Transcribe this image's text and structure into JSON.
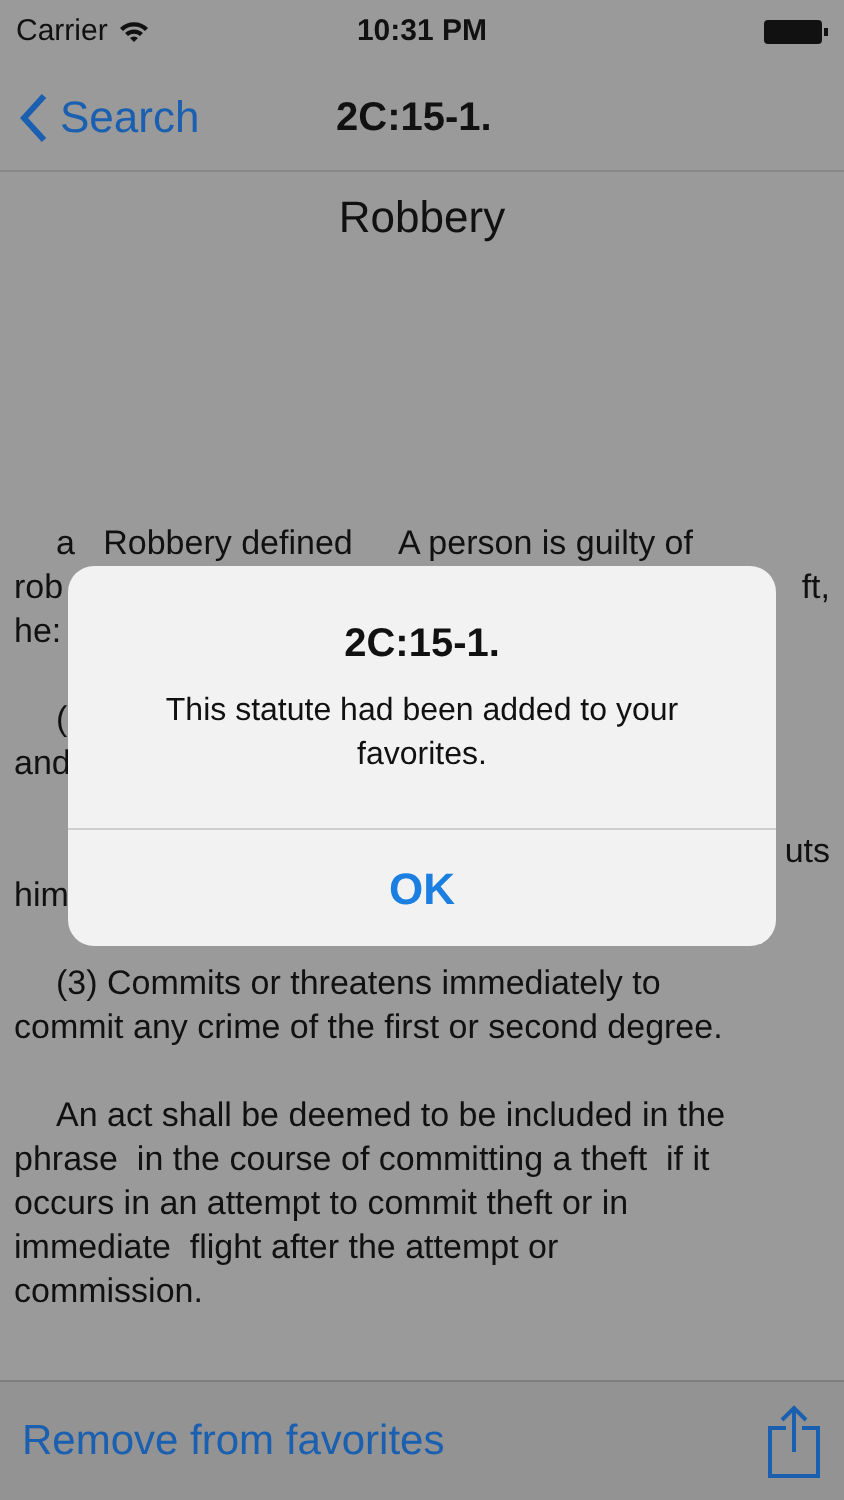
{
  "status_bar": {
    "carrier": "Carrier",
    "time": "10:31 PM"
  },
  "nav": {
    "back": "Search",
    "title": "2C:15-1."
  },
  "document": {
    "heading": "Robbery",
    "paragraphs": [
      {
        "lines": [
          {
            "left": "a   Robbery defined     A person is guilty of",
            "indent": true
          },
          {
            "left": "rob",
            "right": "ft,",
            "indent": false
          },
          {
            "left": "he:",
            "indent": false
          }
        ]
      },
      {
        "lines": [
          {
            "left": "(",
            "indent": true
          },
          {
            "left": "and",
            "indent": false
          }
        ]
      },
      {
        "lines": [
          {
            "right": "uts"
          },
          {
            "left": "him",
            "indent": false
          }
        ]
      },
      {
        "lines": [
          {
            "left": "(3) Commits or threatens immediately to",
            "indent": true
          },
          {
            "left": "commit any crime of the first or second degree.",
            "indent": false
          }
        ]
      },
      {
        "lines": [
          {
            "left": "An act shall be deemed to be included in the",
            "indent": true
          },
          {
            "left": "phrase  in the course of committing a theft  if it",
            "indent": false
          },
          {
            "left": "occurs in an attempt to commit theft or in",
            "indent": false
          },
          {
            "left": "immediate  flight after the attempt or",
            "indent": false
          },
          {
            "left": "commission.",
            "indent": false
          }
        ]
      }
    ]
  },
  "alert": {
    "title": "2C:15-1.",
    "message": "This statute had been added to your favorites.",
    "button": "OK"
  },
  "toolbar": {
    "action": "Remove from favorites"
  }
}
